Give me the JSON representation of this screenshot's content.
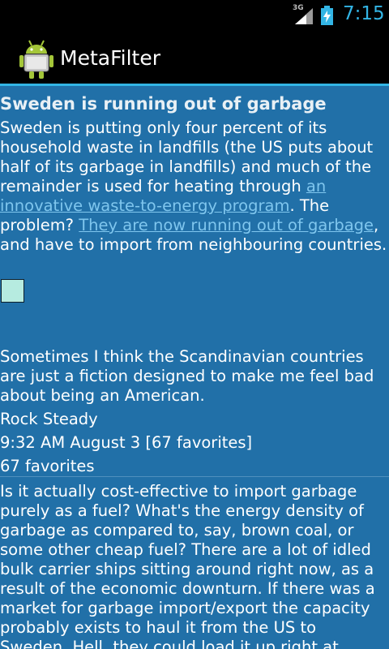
{
  "status_bar": {
    "network": "3G",
    "time": "7:15",
    "icons": [
      "signal-icon",
      "battery-charging-icon"
    ]
  },
  "action_bar": {
    "title": "MetaFilter",
    "icon": "android-app-icon"
  },
  "post": {
    "title": "Sweden is running out of garbage",
    "body_before_link1": "Sweden is putting only four percent of its household waste in landfills (the US puts about half of its garbage in landfills) and much of the remainder is used for heating through ",
    "link1": "an innovative waste-to-energy program",
    "body_between": ". The problem? ",
    "link2": "They are now running out of garbage",
    "body_after": ", and have to import from neighbouring countries."
  },
  "comments": [
    {
      "text": "Sometimes I think the Scandinavian countries are just a fiction designed to make me feel bad about being an American.",
      "author": "Rock Steady",
      "meta": "9:32 AM August 3 [67 favorites]",
      "favorites": "67 favorites"
    },
    {
      "text": "Is it actually cost-effective to import garbage purely as a fuel? What's the energy density of garbage as compared to, say, brown coal, or some other cheap fuel? There are a lot of idled bulk carrier ships sitting around right now, as a result of the economic downturn. If there was a market for garbage import/export the capacity probably exists to haul it from the US to Sweden. Hell, they could load it up right at Newark... it might even"
    }
  ],
  "colors": {
    "background": "#2170a8",
    "accent": "#33b5e5",
    "link": "#7fc6ee",
    "thumbnail": "#b6ebe0"
  }
}
